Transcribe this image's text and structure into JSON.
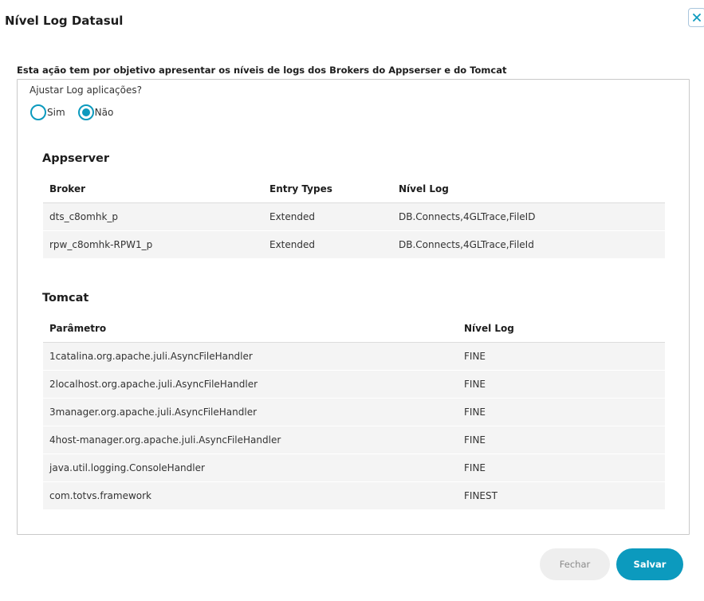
{
  "modal": {
    "title": "Nível Log Datasul",
    "close_icon": "close-icon"
  },
  "description": "Esta ação tem por objetivo apresentar os níveis de logs dos Brokers do Appserser e do Tomcat",
  "adjust": {
    "question": "Ajustar Log aplicações?",
    "options": [
      {
        "label": "Sim",
        "checked": false
      },
      {
        "label": "Não",
        "checked": true
      }
    ]
  },
  "appserver": {
    "title": "Appserver",
    "columns": [
      "Broker",
      "Entry Types",
      "Nível Log"
    ],
    "rows": [
      [
        "dts_c8omhk_p",
        "Extended",
        "DB.Connects,4GLTrace,FileID"
      ],
      [
        "rpw_c8omhk-RPW1_p",
        "Extended",
        "DB.Connects,4GLTrace,FileId"
      ]
    ]
  },
  "tomcat": {
    "title": "Tomcat",
    "columns": [
      "Parâmetro",
      "Nível Log"
    ],
    "rows": [
      [
        "1catalina.org.apache.juli.AsyncFileHandler",
        "FINE"
      ],
      [
        "2localhost.org.apache.juli.AsyncFileHandler",
        "FINE"
      ],
      [
        "3manager.org.apache.juli.AsyncFileHandler",
        "FINE"
      ],
      [
        "4host-manager.org.apache.juli.AsyncFileHandler",
        "FINE"
      ],
      [
        "java.util.logging.ConsoleHandler",
        "FINE"
      ],
      [
        "com.totvs.framework",
        "FINEST"
      ]
    ]
  },
  "buttons": {
    "close_label": "Fechar",
    "save_label": "Salvar"
  },
  "colors": {
    "accent": "#0c9abe",
    "row_stripe": "#f2f2f2",
    "border": "#c9c9c9"
  }
}
